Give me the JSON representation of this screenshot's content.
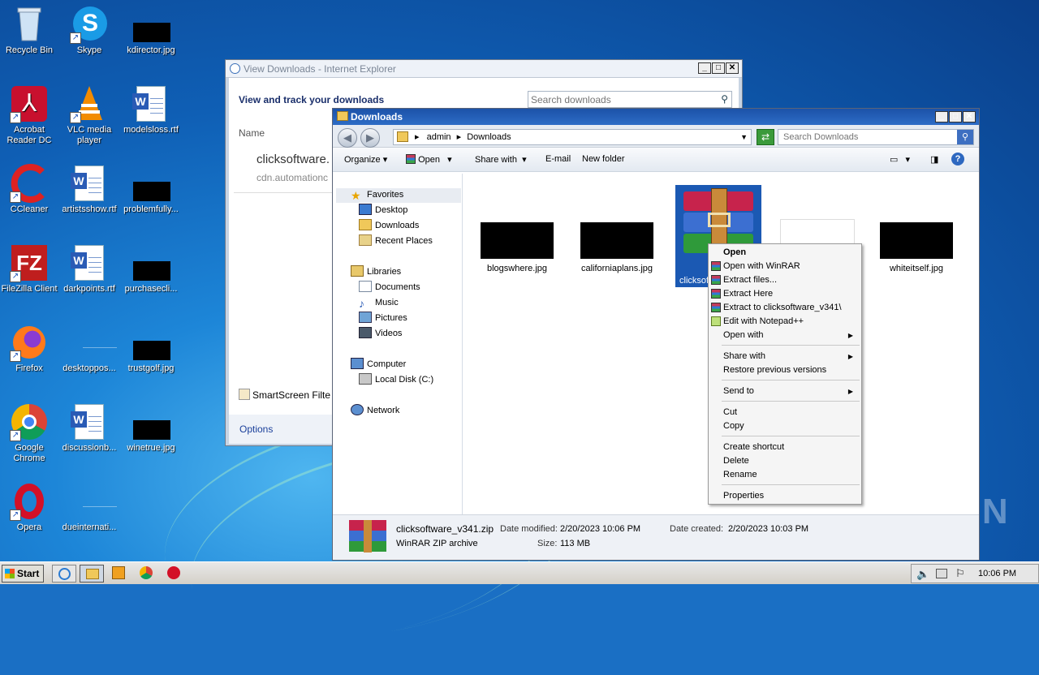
{
  "desktop": {
    "icons": [
      {
        "label": "Recycle Bin"
      },
      {
        "label": "Skype"
      },
      {
        "label": "kdirector.jpg"
      },
      {
        "label": "Acrobat Reader DC"
      },
      {
        "label": "VLC media player"
      },
      {
        "label": "modelsloss.rtf"
      },
      {
        "label": "CCleaner"
      },
      {
        "label": "artistsshow.rtf"
      },
      {
        "label": "problemfully..."
      },
      {
        "label": "FileZilla Client"
      },
      {
        "label": "darkpoints.rtf"
      },
      {
        "label": "purchasecli..."
      },
      {
        "label": "Firefox"
      },
      {
        "label": "desktoppos..."
      },
      {
        "label": "trustgolf.jpg"
      },
      {
        "label": "Google Chrome"
      },
      {
        "label": "discussionb..."
      },
      {
        "label": "winetrue.jpg"
      },
      {
        "label": "Opera"
      },
      {
        "label": "dueinternati..."
      }
    ]
  },
  "ie_window": {
    "title": "View Downloads - Internet Explorer",
    "heading": "View and track your downloads",
    "search_placeholder": "Search downloads",
    "column_name": "Name",
    "item_name": "clicksoftware.",
    "item_source": "cdn.automationc",
    "smartscreen": "SmartScreen Filte",
    "options": "Options"
  },
  "explorer": {
    "title": "Downloads",
    "breadcrumb": [
      "admin",
      "Downloads"
    ],
    "search_placeholder": "Search Downloads",
    "toolbar": {
      "organize": "Organize",
      "open": "Open",
      "share_with": "Share with",
      "email": "E-mail",
      "new_folder": "New folder"
    },
    "nav": {
      "favorites": "Favorites",
      "desktop": "Desktop",
      "downloads": "Downloads",
      "recent_places": "Recent Places",
      "libraries": "Libraries",
      "documents": "Documents",
      "music": "Music",
      "pictures": "Pictures",
      "videos": "Videos",
      "computer": "Computer",
      "local_disk": "Local Disk (C:)",
      "network": "Network"
    },
    "files": [
      {
        "name": "blogswhere.jpg"
      },
      {
        "name": "californiaplans.jpg"
      },
      {
        "name": "clicksof"
      },
      {
        "name": "whiteitself.jpg"
      }
    ],
    "status": {
      "filename": "clicksoftware_v341.zip",
      "type": "WinRAR ZIP archive",
      "modified_label": "Date modified:",
      "modified": "2/20/2023 10:06 PM",
      "size_label": "Size:",
      "size": "113 MB",
      "created_label": "Date created:",
      "created": "2/20/2023 10:03 PM"
    }
  },
  "context_menu": {
    "open": "Open",
    "open_winrar": "Open with WinRAR",
    "extract_files": "Extract files...",
    "extract_here": "Extract Here",
    "extract_to": "Extract to clicksoftware_v341\\",
    "edit_notepad": "Edit with Notepad++",
    "open_with": "Open with",
    "share_with": "Share with",
    "restore": "Restore previous versions",
    "send_to": "Send to",
    "cut": "Cut",
    "copy": "Copy",
    "create_shortcut": "Create shortcut",
    "delete": "Delete",
    "rename": "Rename",
    "properties": "Properties"
  },
  "taskbar": {
    "start": "Start",
    "clock": "10:06 PM"
  },
  "watermark": "ANY RUN"
}
